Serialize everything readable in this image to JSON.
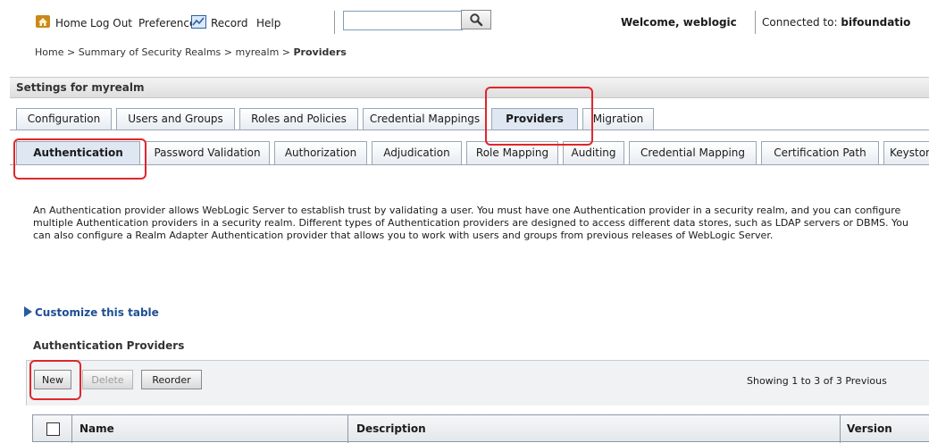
{
  "nav": {
    "home": "Home",
    "logout": "Log Out",
    "preferences": "Preferences",
    "record": "Record",
    "help": "Help",
    "search_value": "",
    "welcome": "Welcome, weblogic",
    "connected_prefix": "Connected to:",
    "connected_domain": "bifoundatio"
  },
  "breadcrumb": {
    "items": [
      "Home >",
      "Summary of Security Realms >",
      "myrealm >"
    ],
    "current": "Providers"
  },
  "settings": {
    "title": "Settings for myrealm",
    "tabs": [
      "Configuration",
      "Users and Groups",
      "Roles and Policies",
      "Credential Mappings",
      "Providers",
      "Migration"
    ],
    "active_tab": "Providers",
    "subtabs": [
      "Authentication",
      "Password Validation",
      "Authorization",
      "Adjudication",
      "Role Mapping",
      "Auditing",
      "Credential Mapping",
      "Certification Path",
      "Keystores"
    ],
    "active_subtab": "Authentication"
  },
  "description": "An Authentication provider allows WebLogic Server to establish trust by validating a user. You must have one Authentication provider in a security realm, and you can configure multiple Authentication providers in a security realm. Different types of Authentication providers are designed to access different data stores, such as LDAP servers or DBMS. You can also configure a Realm Adapter Authentication provider that allows you to work with users and groups from previous releases of WebLogic Server.",
  "customize_link": "Customize this table",
  "table": {
    "title": "Authentication Providers",
    "buttons": {
      "new": "New",
      "delete": "Delete",
      "reorder": "Reorder"
    },
    "showing": "Showing 1 to 3 of 3",
    "previous": "Previous",
    "columns": [
      "Name",
      "Description",
      "Version"
    ]
  },
  "colors": {
    "highlight": "#e0262c",
    "link": "#1f4e94",
    "tab_active": "#dfe8f2"
  },
  "icons": [
    "home-icon",
    "record-icon",
    "search-icon",
    "expand-triangle-icon"
  ]
}
